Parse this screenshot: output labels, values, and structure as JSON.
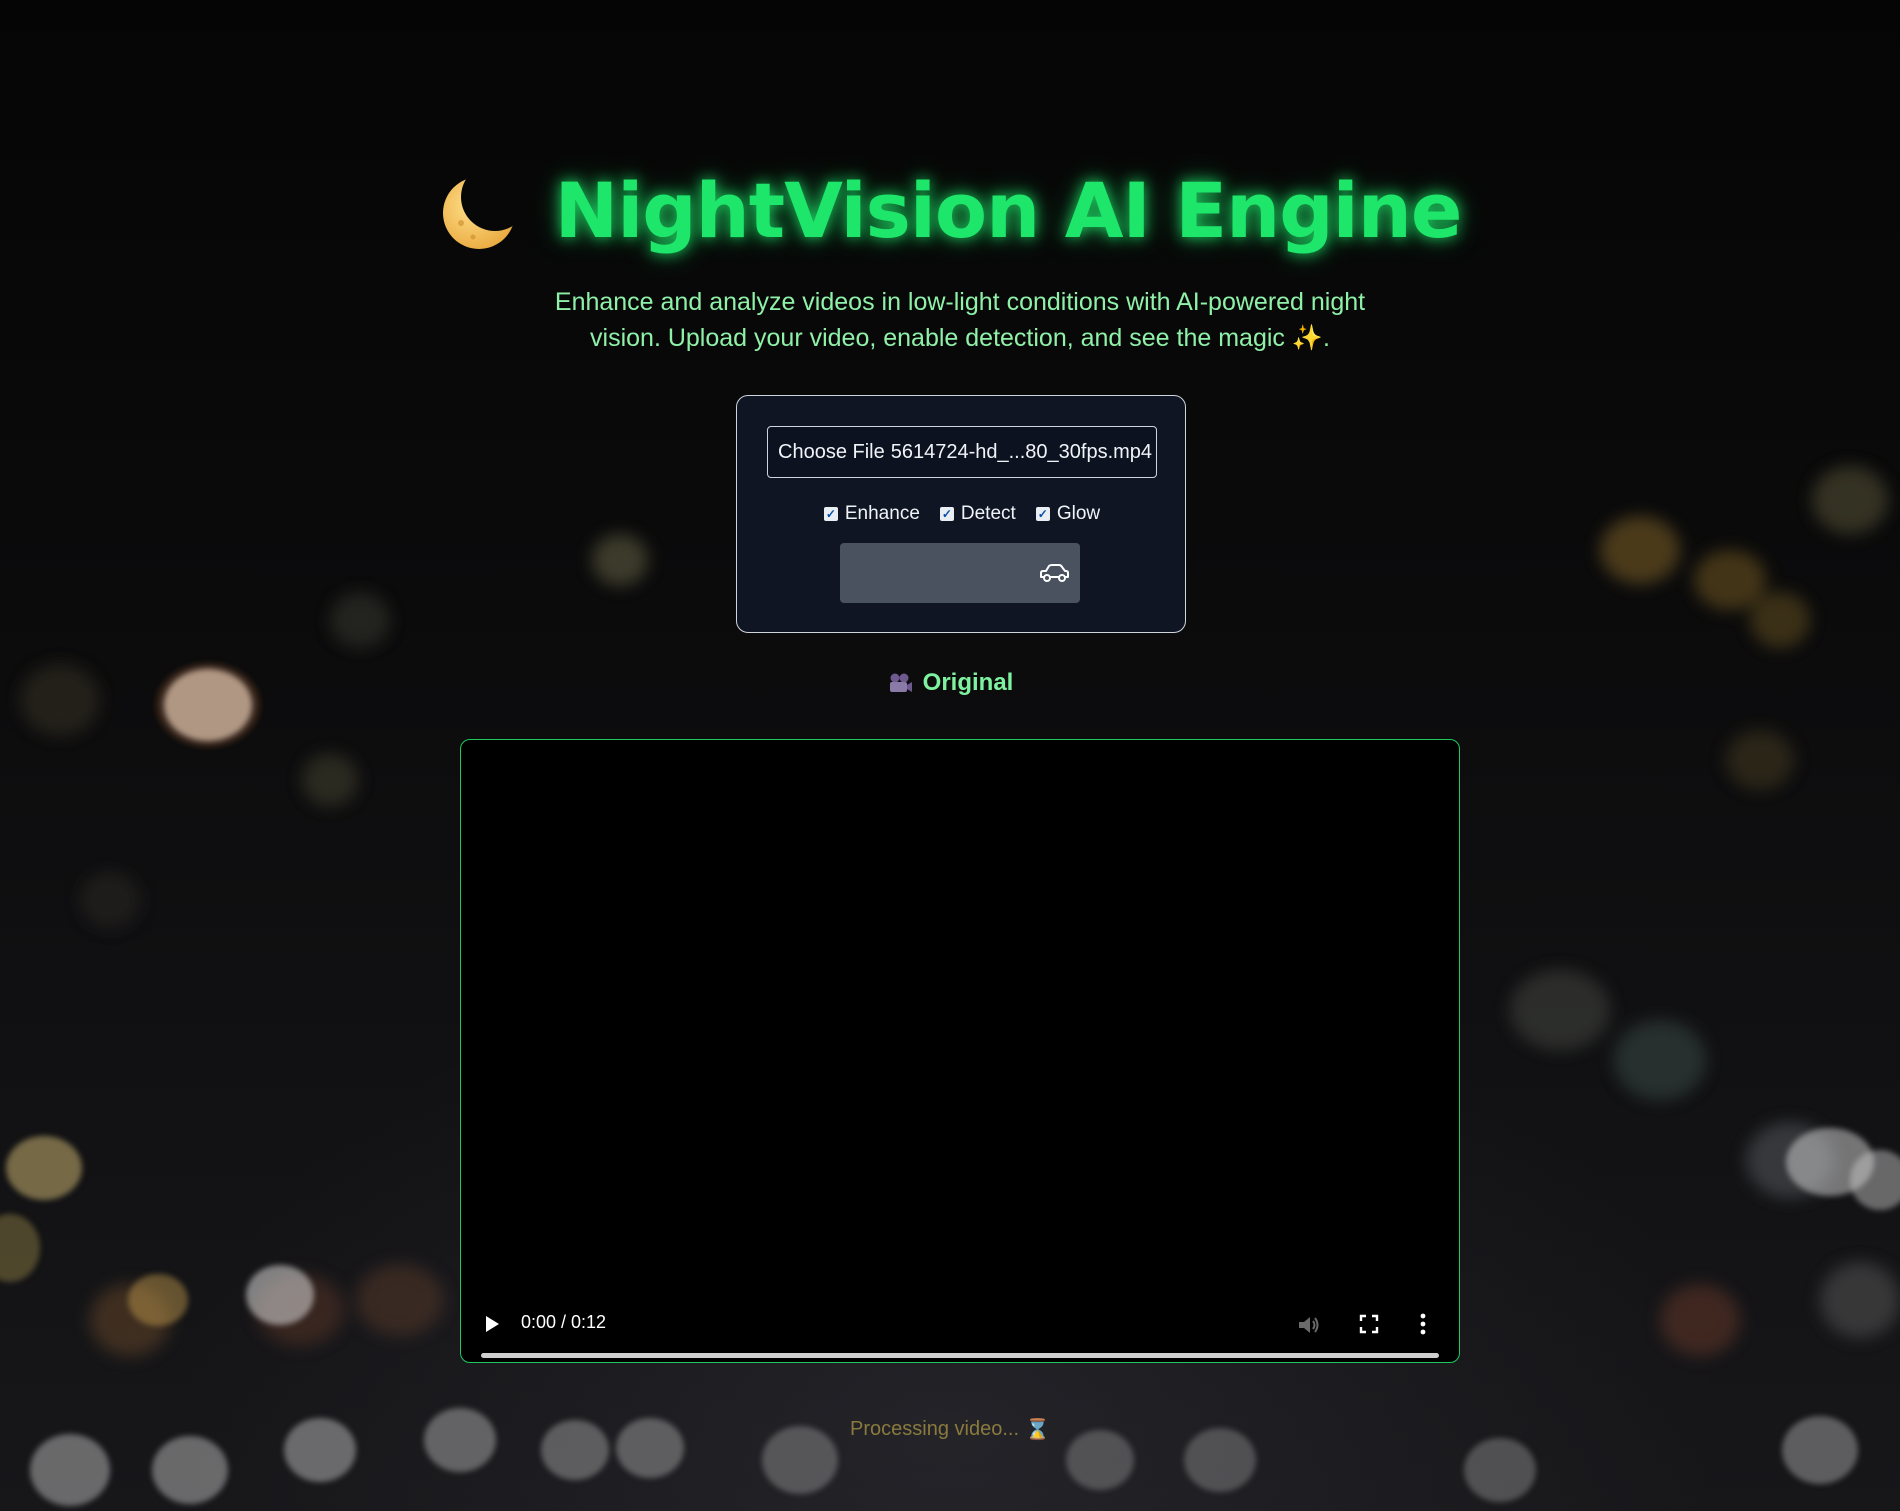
{
  "header": {
    "icon": "crescent-moon-icon",
    "title": "NightVision AI Engine",
    "subtitle_line1": "Enhance and analyze videos in low-light conditions with AI-powered night",
    "subtitle_line2": "vision. Upload your video, enable detection, and see the magic",
    "subtitle_sparkle": "✨",
    "subtitle_end": "."
  },
  "upload": {
    "button_text": "Choose File",
    "file_name": "5614724-hd_...80_30fps.mp4"
  },
  "options": [
    {
      "label": "Enhance",
      "checked": true
    },
    {
      "label": "Detect",
      "checked": true
    },
    {
      "label": "Glow",
      "checked": true
    }
  ],
  "submit": {
    "icon": "car-icon"
  },
  "section": {
    "icon": "movie-camera-icon",
    "label": "Original"
  },
  "video": {
    "time": "0:00 / 0:12",
    "progress": 0
  },
  "status": {
    "text": "Processing video...",
    "icon": "hourglass-icon",
    "glyph": "⌛"
  },
  "colors": {
    "accent": "#1ee66a",
    "subtitle": "#8ff0a8",
    "panel_bg": "#0f1522",
    "button_bg": "#4a525f",
    "video_border": "#1ec85c",
    "status": "#8a7a3d"
  }
}
